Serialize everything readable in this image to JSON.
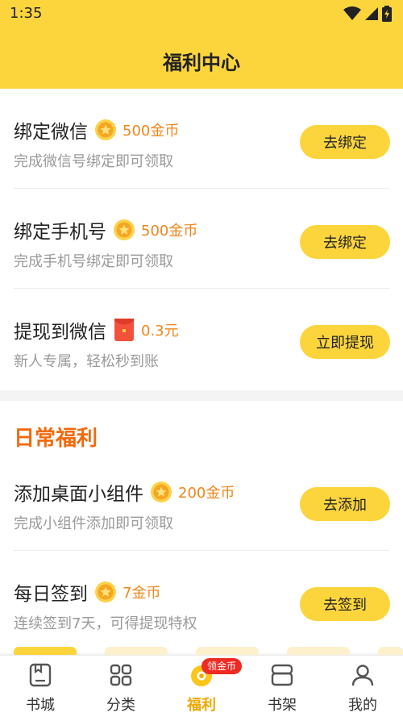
{
  "status_bar": {
    "time": "1:35"
  },
  "header": {
    "title": "福利中心"
  },
  "tasks": [
    {
      "title": "绑定微信",
      "reward": "500金币",
      "reward_icon": "coin-icon",
      "desc": "完成微信号绑定即可领取",
      "button": "去绑定"
    },
    {
      "title": "绑定手机号",
      "reward": "500金币",
      "reward_icon": "coin-icon",
      "desc": "完成手机号绑定即可领取",
      "button": "去绑定"
    },
    {
      "title": "提现到微信",
      "reward": "0.3元",
      "reward_icon": "red-packet-icon",
      "desc": "新人专属，轻松秒到账",
      "button": "立即提现"
    }
  ],
  "daily": {
    "title": "日常福利",
    "items": [
      {
        "title": "添加桌面小组件",
        "reward": "200金币",
        "reward_icon": "coin-icon",
        "desc": "完成小组件添加即可领取",
        "button": "去添加"
      },
      {
        "title": "每日签到",
        "reward": "7金币",
        "reward_icon": "coin-icon",
        "desc": "连续签到7天，可得提现特权",
        "button": "去签到"
      }
    ]
  },
  "tabbar": {
    "badge": "领金币",
    "active": "福利",
    "tabs": [
      {
        "label": "书城",
        "icon": "bookstore-icon"
      },
      {
        "label": "分类",
        "icon": "category-grid-icon"
      },
      {
        "label": "福利",
        "icon": "welfare-coin-icon"
      },
      {
        "label": "书架",
        "icon": "bookshelf-icon"
      },
      {
        "label": "我的",
        "icon": "profile-icon"
      }
    ]
  },
  "colors": {
    "brand_yellow": "#fcd53d",
    "reward_orange": "#f0861a",
    "section_orange": "#f26a0c",
    "badge_red": "#ef2a23"
  }
}
